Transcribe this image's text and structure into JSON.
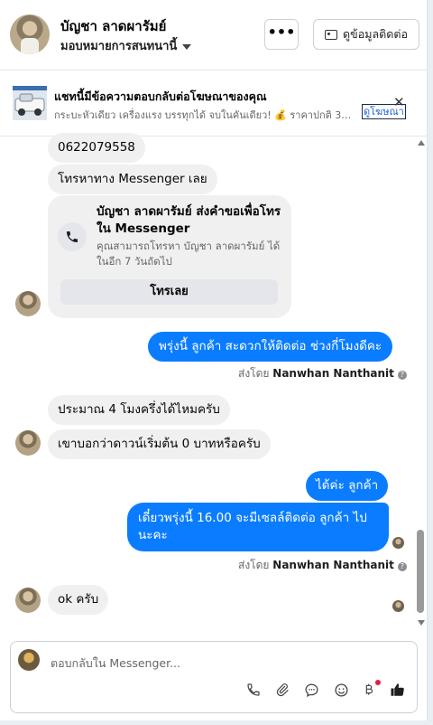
{
  "header": {
    "contact_name": "บัญชา ลาดผารัมย์",
    "assignment": "มอบหมายการสนทนานี้",
    "more_label": "•••",
    "view_contact_label": "ดูข้อมูลติดต่อ"
  },
  "ad_banner": {
    "title": "แชทนี้มีข้อความตอบกลับต่อโฆษณาของคุณ",
    "subtitle": "กระบะหัวเดียว เครื่องแรง บรรทุกได้ จบในคันเดียว! 💰 ราคาปกติ 329,000 ...",
    "link_label": "ดูโฆษณา",
    "close": "✕"
  },
  "messages": {
    "m1": "0622079558",
    "m2": "โทรหาทาง Messenger เลย",
    "call_card": {
      "title": "บัญชา ลาดผารัมย์ ส่งคำขอเพื่อโทรใน Messenger",
      "desc": "คุณสามารถโทรหา บัญชา ลาดผารัมย์ ได้ในอีก 7 วันถัดไป",
      "button": "โทรเลย"
    },
    "m3": "พรุ่งนี้ ลูกค้า สะดวกให้ติดต่อ ช่วงกี่โมงดีคะ",
    "sent_by_prefix": "ส่งโดย",
    "sent_by_name": "Nanwhan Nanthanit",
    "info": "?",
    "m4": "ประมาณ 4 โมงครึ่งได้ไหมครับ",
    "m5": "เขาบอกว่าดาวน์เริ่มต้น 0 บาทหรือครับ",
    "m6": "ได้ค่ะ  ลูกค้า",
    "m7": "เดี๋ยวพรุ่งนี้ 16.00 จะมีเซลล์ติดต่อ ลูกค้า ไปนะคะ",
    "m8": "ok ครับ"
  },
  "composer": {
    "placeholder": "ตอบกลับใน Messenger...",
    "tools": [
      "phone-icon",
      "attachment-icon",
      "chat-bubble-icon",
      "emoji-icon",
      "baht-icon",
      "thumbs-up-icon"
    ]
  },
  "colors": {
    "outgoing": "#0a7cff",
    "incoming": "#f0f0f0",
    "link": "#1b63d6",
    "notification": "#e41e3f"
  }
}
